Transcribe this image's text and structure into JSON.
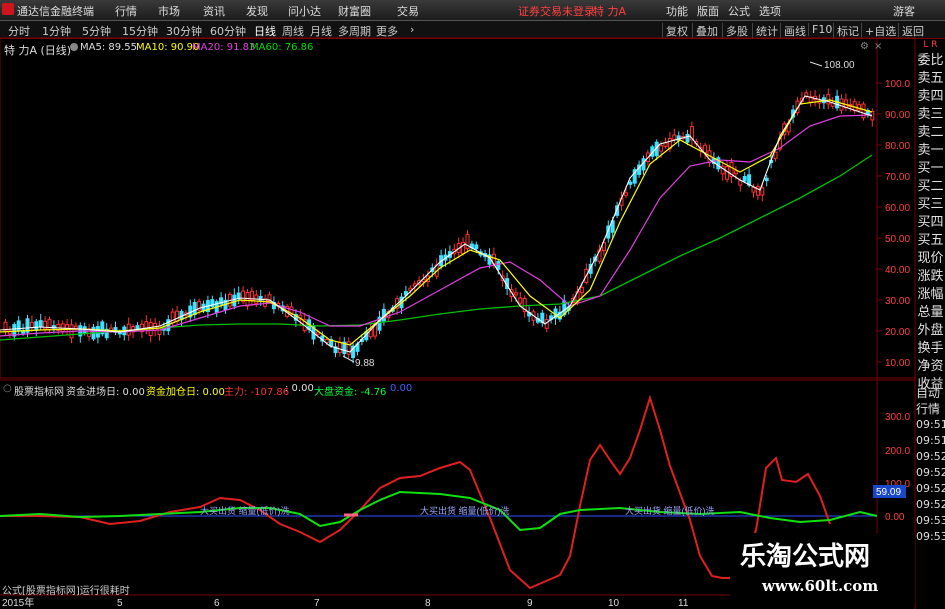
{
  "window": {
    "title": "通达信金融终端",
    "menus": [
      "行情",
      "市场",
      "资讯",
      "发现",
      "问小达",
      "财富圈",
      "交易"
    ],
    "login_status": "证券交易未登录",
    "stock_name": "特 力A",
    "right_menus": [
      "功能",
      "版面",
      "公式",
      "选项"
    ],
    "user": "游客"
  },
  "toolbar": {
    "periods": [
      "分时",
      "1分钟",
      "5分钟",
      "15分钟",
      "30分钟",
      "60分钟",
      "日线",
      "周线",
      "月线",
      "多周期",
      "更多"
    ],
    "selected_period": "日线",
    "right_buttons": [
      "复权",
      "叠加",
      "多股",
      "统计",
      "画线",
      "F10",
      "标记",
      "+自选",
      "返回"
    ]
  },
  "main_chart": {
    "label": "特 力A (日线)",
    "ma_legend": [
      {
        "text": "MA5: 89.55",
        "color": "#ffffff"
      },
      {
        "text": "MA10: 90.90",
        "color": "#ffff00"
      },
      {
        "text": "MA20: 91.83",
        "color": "#e040e0"
      },
      {
        "text": "MA60: 76.86",
        "color": "#00e000"
      }
    ],
    "price_high": "108.00",
    "price_low": "9.88",
    "y_ticks": [
      "100.0",
      "90.00",
      "80.00",
      "70.00",
      "60.00",
      "50.00",
      "40.00",
      "30.00",
      "20.00",
      "10.00"
    ]
  },
  "sub_chart": {
    "indicator_name": "股票指标网",
    "items": [
      {
        "text": "资金进场日: 0.00",
        "color": "#dddddd"
      },
      {
        "text": "资金加仓日: 0.00",
        "color": "#ffff00"
      },
      {
        "text": "主力: -107.86",
        "color": "#ff3030"
      },
      {
        "text": ": 0.00",
        "color": "#dddddd"
      },
      {
        "text": "大盘资金: -4.76",
        "color": "#00ff40"
      },
      {
        "text": "0.00",
        "color": "#4060ff"
      }
    ],
    "y_ticks": [
      "300.0",
      "200.0",
      "100.0",
      "0.00"
    ],
    "current_value": "59.09",
    "annotation": "大买出货 缩量(低价)洗",
    "footer_text": "公式[股票指标网]运行很耗时"
  },
  "x_axis": [
    "2015年",
    "5",
    "6",
    "7",
    "8",
    "9",
    "10",
    "11"
  ],
  "sidebar": {
    "corner": "L R",
    "items": [
      "委比",
      "卖五",
      "卖四",
      "卖三",
      "卖二",
      "卖一",
      "买一",
      "买二",
      "买三",
      "买四",
      "买五",
      "现价",
      "涨跌",
      "涨幅",
      "总量",
      "外盘",
      "换手",
      "净资",
      "收益"
    ]
  },
  "sidebar2": {
    "items": [
      "自动",
      "行情",
      "09:51",
      "09:51",
      "09:52",
      "09:52",
      "09:52",
      "09:52",
      "09:53",
      "09:53"
    ]
  },
  "watermark": {
    "title": "乐淘公式网",
    "url": "www.60lt.com"
  }
}
